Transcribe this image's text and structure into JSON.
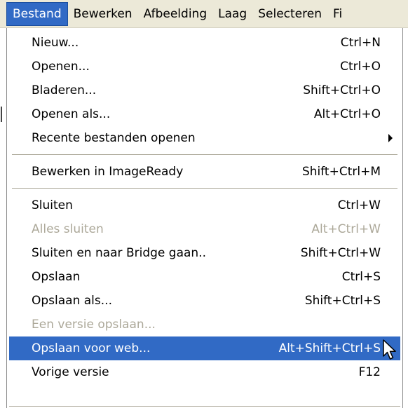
{
  "menubar": {
    "items": [
      {
        "label": "Bestand",
        "active": true
      },
      {
        "label": "Bewerken"
      },
      {
        "label": "Afbeelding"
      },
      {
        "label": "Laag"
      },
      {
        "label": "Selecteren"
      },
      {
        "label": "Fi"
      }
    ]
  },
  "menu": {
    "group1": [
      {
        "label": "Nieuw...",
        "shortcut": "Ctrl+N"
      },
      {
        "label": "Openen...",
        "shortcut": "Ctrl+O"
      },
      {
        "label": "Bladeren...",
        "shortcut": "Shift+Ctrl+O"
      },
      {
        "label": "Openen als...",
        "shortcut": "Alt+Ctrl+O"
      },
      {
        "label": "Recente bestanden openen",
        "shortcut": ""
      }
    ],
    "group2": [
      {
        "label": "Bewerken in ImageReady",
        "shortcut": "Shift+Ctrl+M"
      }
    ],
    "group3": [
      {
        "label": "Sluiten",
        "shortcut": "Ctrl+W"
      },
      {
        "label": "Alles sluiten",
        "shortcut": "Alt+Ctrl+W",
        "disabled": true
      },
      {
        "label": "Sluiten en naar Bridge gaan..",
        "shortcut": "Shift+Ctrl+W"
      },
      {
        "label": "Opslaan",
        "shortcut": "Ctrl+S"
      },
      {
        "label": "Opslaan als...",
        "shortcut": "Shift+Ctrl+S"
      },
      {
        "label": "Een versie opslaan...",
        "shortcut": "",
        "disabled": true
      },
      {
        "label": "Opslaan voor web...",
        "shortcut": "Alt+Shift+Ctrl+S",
        "highlighted": true
      },
      {
        "label": "Vorige versie",
        "shortcut": "F12"
      }
    ]
  },
  "colors": {
    "highlight": "#316ac5",
    "disabled_text": "#aca899",
    "menubar_bg": "#ece9d8"
  },
  "icons": {
    "submenu": "triangle-right-icon",
    "cursor": "mouse-pointer-icon"
  }
}
